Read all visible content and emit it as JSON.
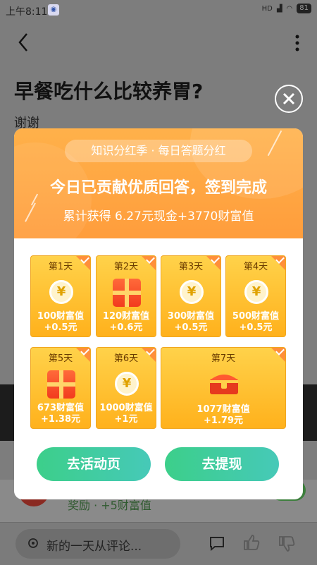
{
  "status_bar": {
    "time": "上午8:11",
    "network": "HD",
    "battery": "81"
  },
  "question": {
    "title": "早餐吃什么比较养胃?",
    "subtitle": "谢谢"
  },
  "background_feed": {
    "reward_text": "奖励 · +5财富值"
  },
  "bottom_bar": {
    "comment_placeholder": "新的一天从评论..."
  },
  "modal": {
    "season": "知识分红季 · 每日答题分红",
    "headline": "今日已贡献优质回答，签到完成",
    "total": "累计获得 6.27元现金+3770财富值",
    "days": [
      {
        "label": "第1天",
        "value": "100财富值",
        "cash": "+0.5元",
        "icon": "coin-icon"
      },
      {
        "label": "第2天",
        "value": "120财富值",
        "cash": "+0.6元",
        "icon": "gift-icon"
      },
      {
        "label": "第3天",
        "value": "300财富值",
        "cash": "+0.5元",
        "icon": "coin-icon"
      },
      {
        "label": "第4天",
        "value": "500财富值",
        "cash": "+0.5元",
        "icon": "coin-icon"
      },
      {
        "label": "第5天",
        "value": "673财富值",
        "cash": "+1.38元",
        "icon": "gift-icon"
      },
      {
        "label": "第6天",
        "value": "1000财富值",
        "cash": "+1元",
        "icon": "coin-icon"
      },
      {
        "label": "第7天",
        "value": "1077财富值",
        "cash": "+1.79元",
        "icon": "chest-icon"
      }
    ],
    "buttons": {
      "activity": "去活动页",
      "withdraw": "去提现"
    }
  },
  "colors": {
    "header_orange": "#ff9d3c",
    "card_gold": "#ffb11c",
    "button_green": "#3ccf8a"
  }
}
